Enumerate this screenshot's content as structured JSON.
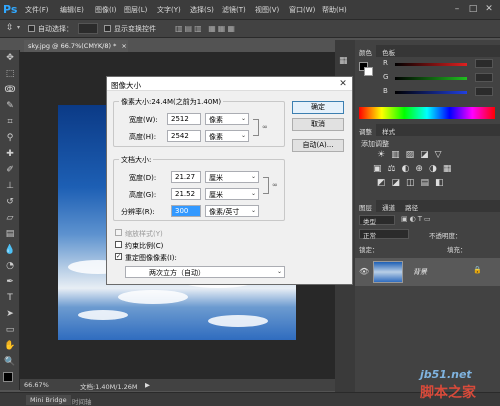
{
  "app": {
    "logo": "Ps",
    "menu": [
      "文件(F)",
      "编辑(E)",
      "图像(I)",
      "图层(L)",
      "文字(Y)",
      "选择(S)",
      "滤镜(T)",
      "视图(V)",
      "窗口(W)",
      "帮助(H)"
    ],
    "window_controls": {
      "minimize": "–",
      "maximize": "□",
      "close": "✕"
    }
  },
  "options_bar": {
    "auto_select_label": "自动选择：",
    "auto_select_value": "",
    "show_transform_label": "显示变换控件"
  },
  "document": {
    "tab_title": "sky.jpg @ 66.7%(CMYK/8) *",
    "tab_close": "×",
    "zoom": "66.67%",
    "doc_info": "文档:1.40M/1.26M",
    "arrow": "▶"
  },
  "bottom_tabs": [
    "Mini Bridge",
    "时间轴"
  ],
  "right_panels": {
    "color_tabs": [
      "颜色",
      "色板"
    ],
    "color_sliders": [
      {
        "label": "R",
        "color": "#e02020",
        "value": ""
      },
      {
        "label": "G",
        "color": "#20c020",
        "value": ""
      },
      {
        "label": "B",
        "color": "#2040e0",
        "value": ""
      }
    ],
    "adjust_tabs": [
      "调整",
      "样式"
    ],
    "adjust_title": "添加调整",
    "layers_tabs": [
      "图层",
      "通道",
      "路径"
    ],
    "layers_kind": "类型",
    "layers_blend": "正常",
    "layers_opacity_label": "不透明度：",
    "layers_lock_label": "锁定：",
    "layers_fill_label": "填充：",
    "layer_name": "背景",
    "lock_icon": "🔒"
  },
  "dialog": {
    "title": "图像大小",
    "close": "✕",
    "pixel_dimensions_label": "像素大小:24.4M(之前为1.40M)",
    "width_label": "宽度(W):",
    "width_value": "2512",
    "width_unit": "像素",
    "height_label": "高度(H):",
    "height_value": "2542",
    "height_unit": "像素",
    "doc_size_label": "文档大小:",
    "doc_width_label": "宽度(D):",
    "doc_width_value": "21.27",
    "doc_width_unit": "厘米",
    "doc_height_label": "高度(G):",
    "doc_height_value": "21.52",
    "doc_height_unit": "厘米",
    "resolution_label": "分辨率(R):",
    "resolution_value": "300",
    "resolution_unit": "像素/英寸",
    "scale_styles_label": "缩放样式(Y)",
    "constrain_label": "约束比例(C)",
    "resample_label": "重定图像像素(I):",
    "resample_value": "两次立方（自动）",
    "ok_label": "确定",
    "cancel_label": "取消",
    "auto_label": "自动(A)...",
    "constrain_checked": "✓",
    "resample_checked": "✓",
    "dropdown_arrow": "⌄"
  },
  "watermark": {
    "url": "jb51.net",
    "name": "脚本之家"
  }
}
